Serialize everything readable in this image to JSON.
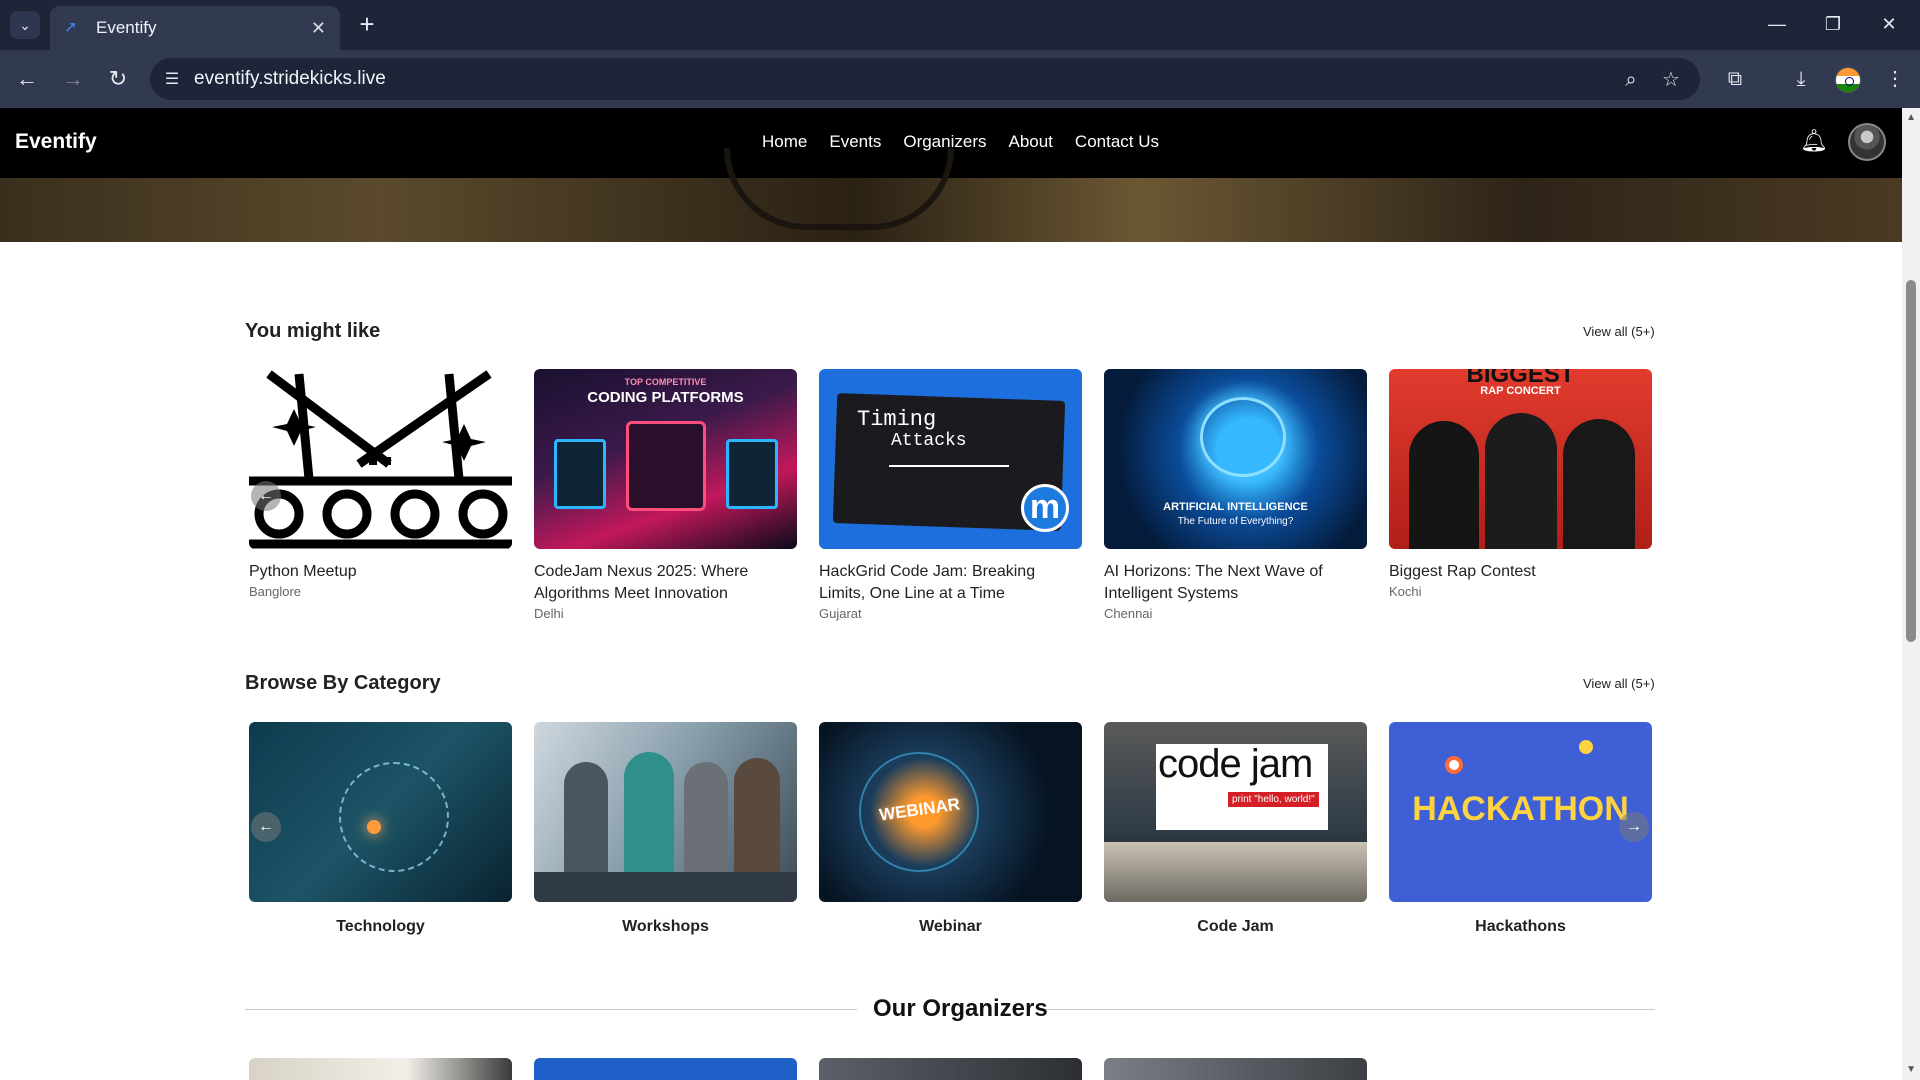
{
  "browser": {
    "tab_title": "Eventify",
    "url": "eventify.stridekicks.live"
  },
  "site": {
    "brand": "Eventify",
    "menu": [
      "Home",
      "Events",
      "Organizers",
      "About",
      "Contact Us"
    ]
  },
  "you_might_like": {
    "title": "You might like",
    "view_all": "View all (5+)",
    "events": [
      {
        "title": "Python Meetup",
        "city": "Banglore"
      },
      {
        "title": "CodeJam Nexus 2025: Where Algorithms Meet Innovation",
        "city": "Delhi"
      },
      {
        "title": "HackGrid Code Jam: Breaking Limits, One Line at a Time",
        "city": "Gujarat"
      },
      {
        "title": "AI Horizons: The Next Wave of Intelligent Systems",
        "city": "Chennai"
      },
      {
        "title": "Biggest Rap Contest",
        "city": "Kochi"
      }
    ],
    "thumb_text": {
      "codejam_line1": "TOP COMPETITIVE",
      "codejam_line2": "CODING PLATFORMS",
      "timing_line1": "Timing",
      "timing_line2": "Attacks",
      "ai_line1": "ARTIFICIAL INTELLIGENCE",
      "ai_line2": "The Future of Everything?",
      "rap_line1": "BIGGEST",
      "rap_line2": "RAP CONCERT"
    }
  },
  "browse_by_category": {
    "title": "Browse By Category",
    "view_all": "View all (5+)",
    "categories": [
      "Technology",
      "Workshops",
      "Webinar",
      "Code Jam",
      "Hackathons"
    ],
    "thumb_text": {
      "webinar": "WEBINAR",
      "codejam_big": "code jam",
      "codejam_small": "print \"hello, world!\"",
      "hackathon": "HACKATHON"
    }
  },
  "organizers": {
    "title": "Our Organizers"
  }
}
